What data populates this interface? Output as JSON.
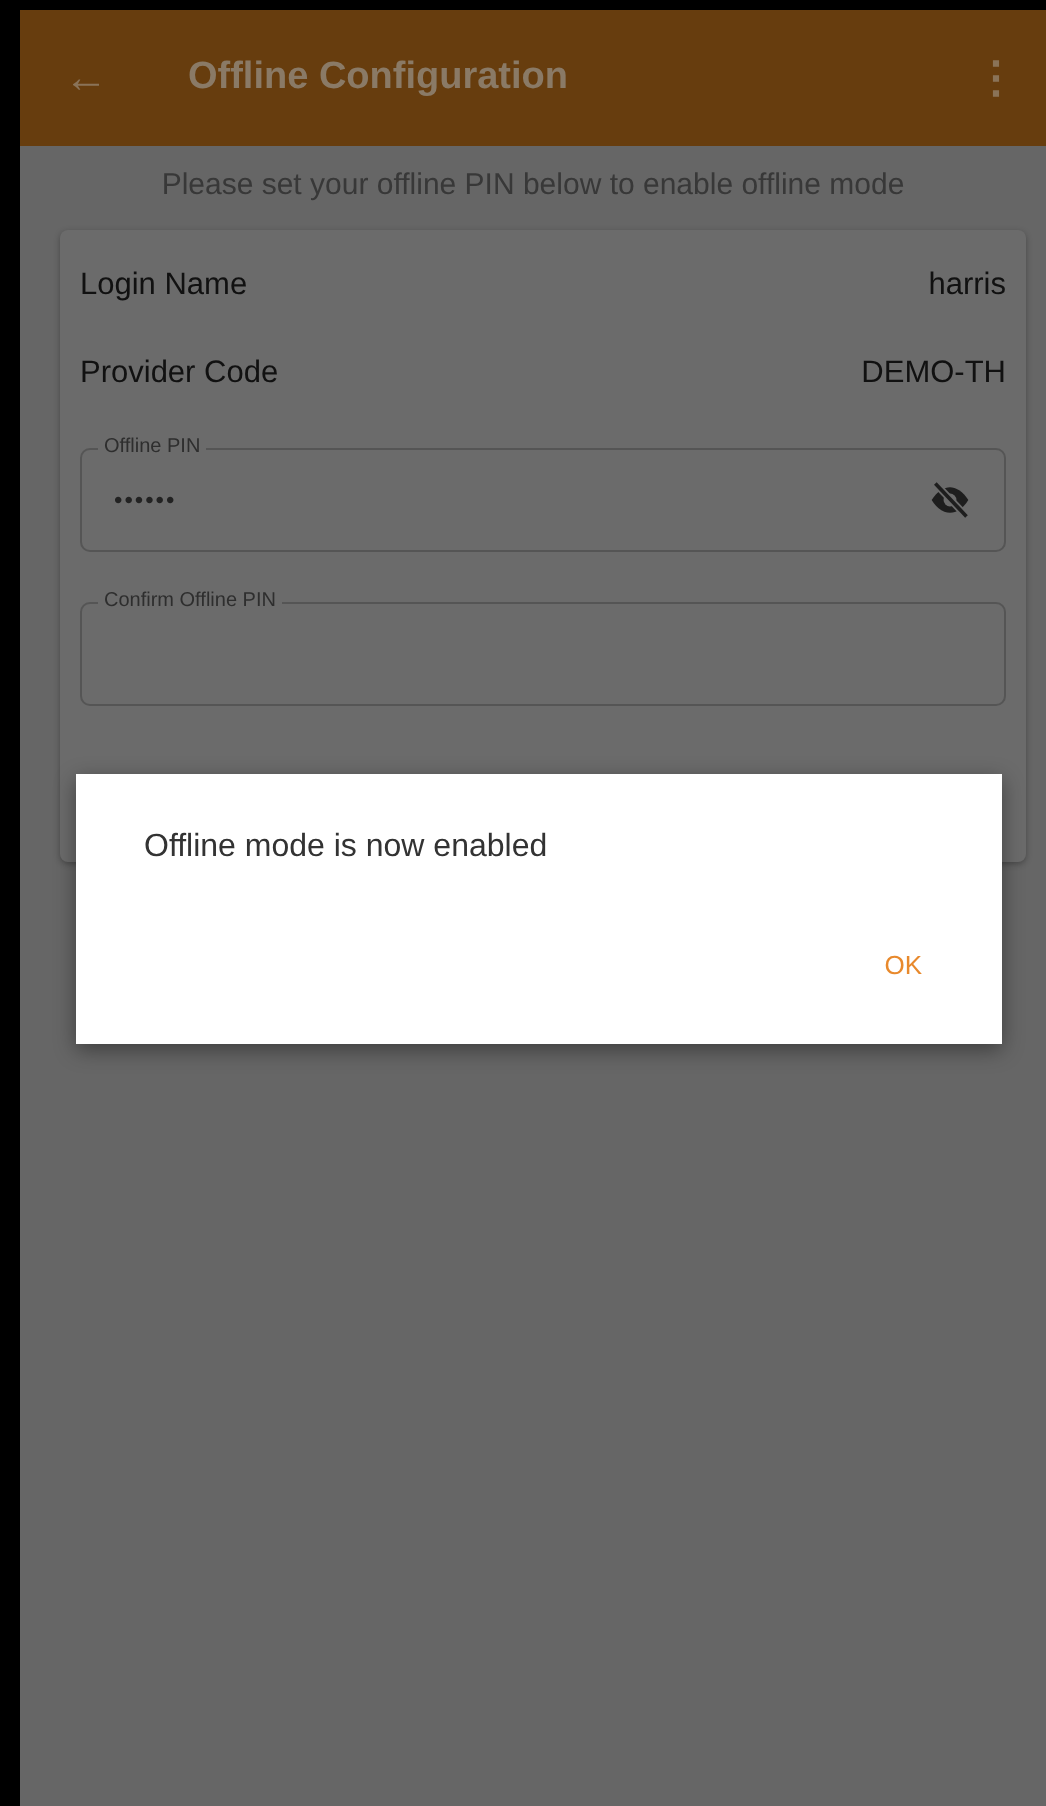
{
  "app_bar": {
    "back": "←",
    "title": "Offline Configuration",
    "menu": "⋮"
  },
  "instruction": "Please set your offline PIN below to enable offline mode",
  "info_rows": [
    {
      "label": "Login Name",
      "value": "harris"
    },
    {
      "label": "Provider Code",
      "value": "DEMO-TH"
    }
  ],
  "pin_fields": [
    {
      "label": "Offline PIN",
      "value": "••••••",
      "show_toggle": true
    },
    {
      "label": "Confirm Offline PIN",
      "show_toggle": false
    }
  ],
  "dialog": {
    "message": "Offline mode is now enabled",
    "buttons": [
      "OK"
    ]
  }
}
